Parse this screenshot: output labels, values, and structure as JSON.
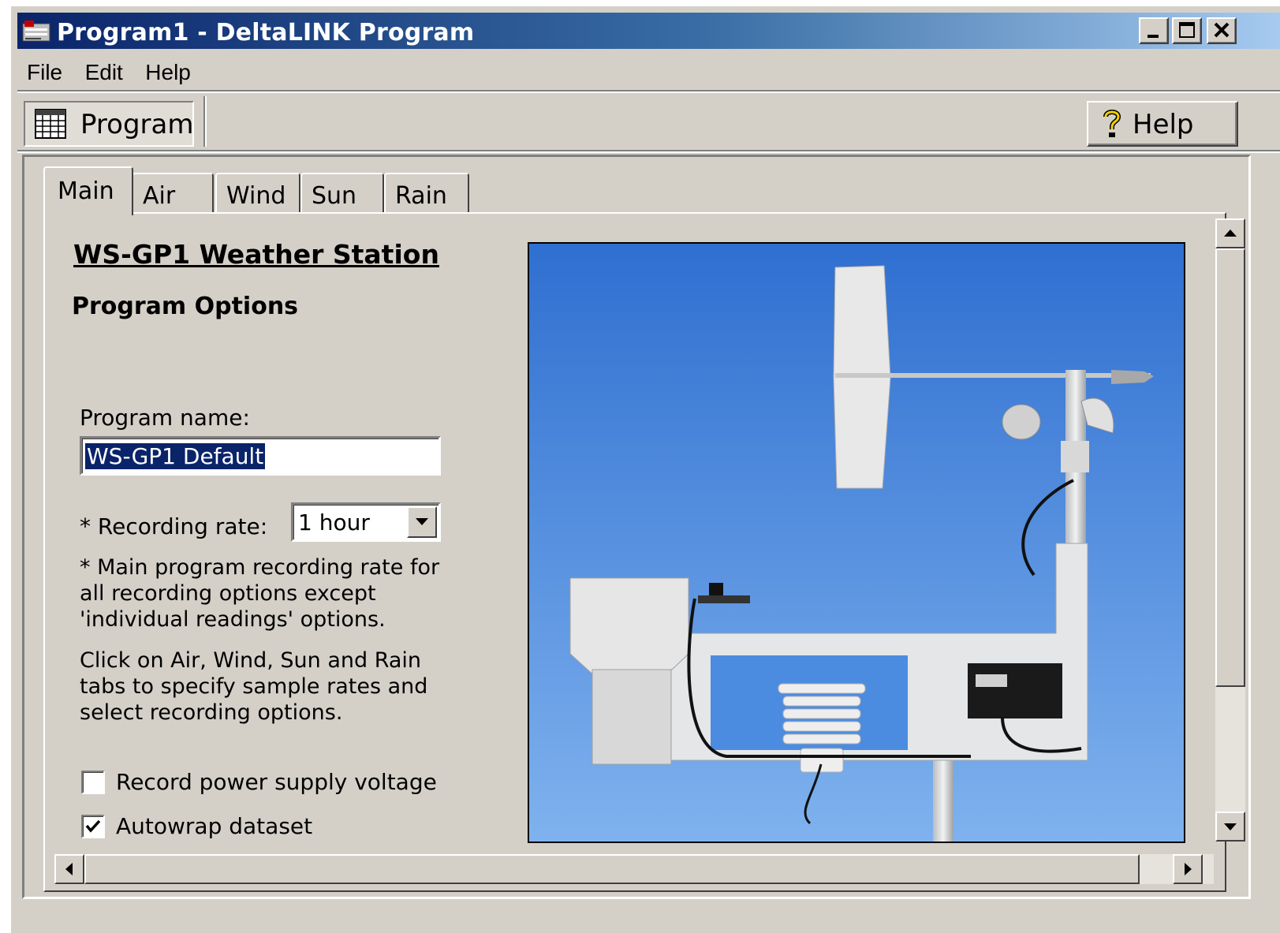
{
  "window": {
    "title": "Program1 - DeltaLINK Program"
  },
  "menu": {
    "file": "File",
    "edit": "Edit",
    "help": "Help"
  },
  "toolbar": {
    "program_label": "Program",
    "help_label": "Help"
  },
  "tabs": [
    {
      "label": "Main",
      "active": true
    },
    {
      "label": "Air"
    },
    {
      "label": "Wind"
    },
    {
      "label": "Sun"
    },
    {
      "label": "Rain"
    }
  ],
  "main": {
    "station_title": "WS-GP1 Weather Station",
    "section_title": "Program Options",
    "program_name_label": "Program name:",
    "program_name_value": "WS-GP1 Default",
    "recording_rate_label": "* Recording rate:",
    "recording_rate_value": "1 hour",
    "note1": "* Main program recording rate for all recording options except 'individual readings' options.",
    "note2": "Click on Air, Wind, Sun and Rain tabs to specify sample rates and select recording options.",
    "record_voltage_label": "Record power supply voltage",
    "record_voltage_checked": false,
    "autowrap_label": "Autowrap dataset",
    "autowrap_checked": true
  },
  "colors": {
    "title_gradient_start": "#0a246a",
    "title_gradient_end": "#a6caf0",
    "face": "#d4d0c8",
    "selection": "#0a246a",
    "sky_top": "#2f6fd0",
    "sky_bottom": "#7fb2ee"
  }
}
